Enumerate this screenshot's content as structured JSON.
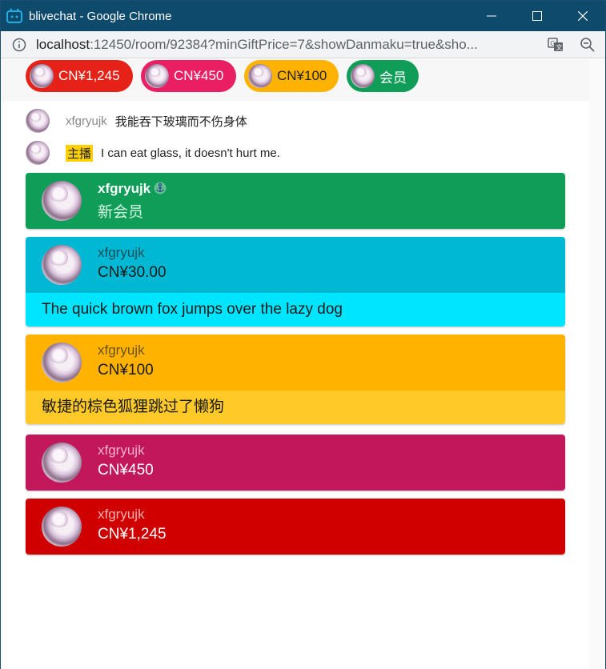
{
  "window": {
    "title": "blivechat - Google Chrome"
  },
  "address": {
    "host": "localhost",
    "rest": ":12450/room/92384?minGiftPrice=7&showDanmaku=true&sho..."
  },
  "ticker": [
    {
      "text": "CN¥1,245",
      "color": "#e62117"
    },
    {
      "text": "CN¥450",
      "color": "#e91e63"
    },
    {
      "text": "CN¥100",
      "color": "#ffb300"
    },
    {
      "text": "会员",
      "color": "#0f9d58"
    }
  ],
  "chat": [
    {
      "name": "xfgryujk",
      "message": "我能吞下玻璃而不伤身体"
    },
    {
      "badge": "主播",
      "message": "I can eat glass, it doesn't hurt me."
    }
  ],
  "cards": [
    {
      "name": "xfgryujk",
      "sub": "新会员",
      "body": "",
      "head_color": "#0f9d58",
      "body_color": "",
      "name_color": "#ffffff",
      "sub_color": "#d6f5e3"
    },
    {
      "name": "xfgryujk",
      "sub": "CN¥30.00",
      "body": "The quick brown fox jumps over the lazy dog",
      "head_color": "#00b8d4",
      "body_color": "#00e5ff",
      "name_color": "#1f4e5a",
      "sub_color": "#1a1a1a"
    },
    {
      "name": "xfgryujk",
      "sub": "CN¥100",
      "body": "敏捷的棕色狐狸跳过了懒狗",
      "head_color": "#ffb300",
      "body_color": "#ffca28",
      "name_color": "#6b5320",
      "sub_color": "#1a1a1a"
    },
    {
      "name": "xfgryujk",
      "sub": "CN¥450",
      "body": "",
      "head_color": "#c2185b",
      "body_color": "",
      "name_color": "#f3b0cc",
      "sub_color": "#ffffff"
    },
    {
      "name": "xfgryujk",
      "sub": "CN¥1,245",
      "body": "",
      "head_color": "#d00000",
      "body_color": "",
      "name_color": "#f5b0b0",
      "sub_color": "#ffffff"
    }
  ]
}
